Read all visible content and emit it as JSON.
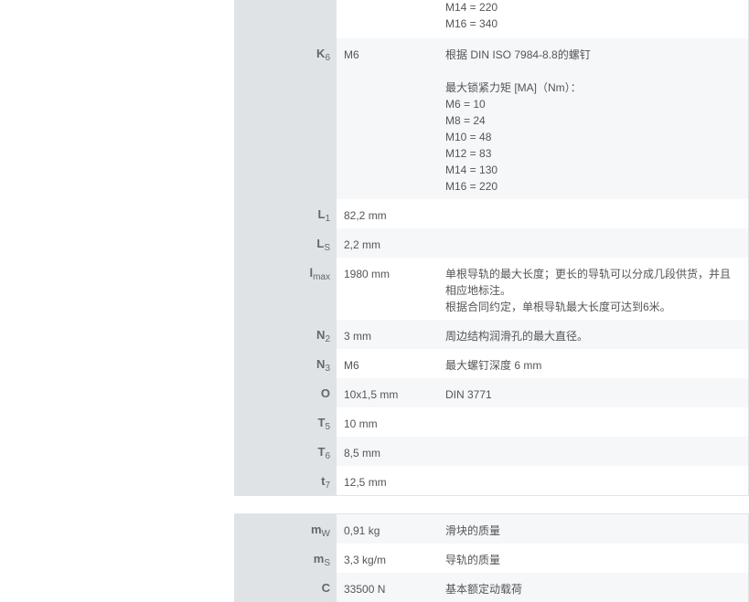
{
  "table1": [
    {
      "sym": "",
      "sub": "",
      "val": "",
      "lines": [
        "M14 = 220",
        "M16 = 340"
      ],
      "h": 52,
      "bg": "white"
    },
    {
      "sym": "K",
      "sub": "6",
      "val": "M6",
      "lines": [
        "根据 DIN ISO 7984-8.8的螺钉",
        "",
        "最大锁紧力矩 [MA]（Nm）：",
        "M6 = 10",
        "M8 = 24",
        "M10 = 48",
        "M12 = 83",
        "M14 = 130",
        "M16 = 220"
      ],
      "h": 176,
      "bg": "alt"
    },
    {
      "sym": "L",
      "sub": "1",
      "val": "82,2  mm",
      "lines": [],
      "h": 32,
      "bg": "white"
    },
    {
      "sym": "L",
      "sub": "S",
      "val": "2,2  mm",
      "lines": [],
      "h": 32,
      "bg": "alt"
    },
    {
      "sym": "l",
      "sub": "max",
      "val": "1980  mm",
      "lines": [
        "单根导轨的最大长度；更长的导轨可以分成几段供货，并且",
        "相应地标注。",
        "根据合同约定，单根导轨最大长度可达到6米。"
      ],
      "h": 68,
      "bg": "white"
    },
    {
      "sym": "N",
      "sub": "2",
      "val": "3  mm",
      "lines": [
        "周边结构润滑孔的最大直径。"
      ],
      "h": 32,
      "bg": "alt"
    },
    {
      "sym": "N",
      "sub": "3",
      "val": "M6",
      "lines": [
        "最大螺钉深度 6 mm"
      ],
      "h": 32,
      "bg": "white"
    },
    {
      "sym": "O",
      "sub": "",
      "val": "10x1,5  mm",
      "lines": [
        "DIN 3771"
      ],
      "h": 32,
      "bg": "alt"
    },
    {
      "sym": "T",
      "sub": "5",
      "val": "10  mm",
      "lines": [],
      "h": 32,
      "bg": "white"
    },
    {
      "sym": "T",
      "sub": "6",
      "val": "8,5  mm",
      "lines": [],
      "h": 32,
      "bg": "alt"
    },
    {
      "sym": "t",
      "sub": "7",
      "val": "12,5  mm",
      "lines": [],
      "h": 32,
      "bg": "white"
    }
  ],
  "table2": [
    {
      "sym": "m",
      "sub": "W",
      "val": "0,91  kg",
      "lines": [
        "滑块的质量"
      ],
      "h": 32,
      "bg": "alt"
    },
    {
      "sym": "m",
      "sub": "S",
      "val": "3,3  kg/m",
      "lines": [
        "导轨的质量"
      ],
      "h": 32,
      "bg": "white"
    },
    {
      "sym": "C",
      "sub": "",
      "val": "33500  N",
      "lines": [
        "基本额定动载荷"
      ],
      "h": 32,
      "bg": "alt"
    }
  ]
}
